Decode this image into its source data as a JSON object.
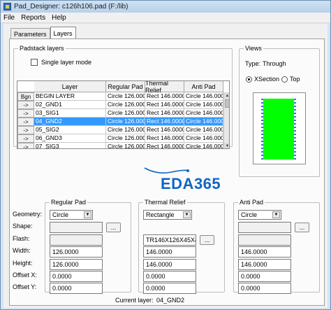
{
  "window": {
    "title": "Pad_Designer: c126h106.pad (F:/lib)"
  },
  "menu": {
    "items": [
      "File",
      "Reports",
      "Help"
    ]
  },
  "tabs": [
    {
      "label": "Parameters",
      "active": false
    },
    {
      "label": "Layers",
      "active": true
    }
  ],
  "padstack": {
    "group_label": "Padstack layers",
    "single_layer_mode_label": "Single layer mode",
    "single_layer_mode_checked": false,
    "bgn_label": "Bgn",
    "columns": [
      "Layer",
      "Regular Pad",
      "Thermal Relief",
      "Anti Pad"
    ],
    "rows": [
      {
        "marker": "",
        "layer": "BEGIN LAYER",
        "regular": "Circle 126.0000",
        "thermal": "Rect 146.0000",
        "anti": "Circle 146.0000",
        "selected": false
      },
      {
        "marker": "->",
        "layer": "02_GND1",
        "regular": "Circle 126.0000",
        "thermal": "Rect 146.0000",
        "anti": "Circle 146.0000",
        "selected": false
      },
      {
        "marker": "->",
        "layer": "03_SIG1",
        "regular": "Circle 126.0000",
        "thermal": "Rect 146.0000",
        "anti": "Circle 146.0000",
        "selected": false
      },
      {
        "marker": "->",
        "layer": "04_GND2",
        "regular": "Circle 126.0000",
        "thermal": "Rect 146.0000",
        "anti": "Circle 146.0000",
        "selected": true
      },
      {
        "marker": "->",
        "layer": "05_SIG2",
        "regular": "Circle 126.0000",
        "thermal": "Rect 146.0000",
        "anti": "Circle 146.0000",
        "selected": false
      },
      {
        "marker": "->",
        "layer": "06_GND3",
        "regular": "Circle 126.0000",
        "thermal": "Rect 146.0000",
        "anti": "Circle 146.0000",
        "selected": false
      },
      {
        "marker": "->",
        "layer": "07_SIG3",
        "regular": "Circle 126.0000",
        "thermal": "Rect 146.0000",
        "anti": "Circle 146.0000",
        "selected": false
      }
    ]
  },
  "views": {
    "group_label": "Views",
    "type_label": "Type:",
    "type_value": "Through",
    "xsection_label": "XSection",
    "top_label": "Top",
    "selected_view": "XSection",
    "pad_color": "#00ff00"
  },
  "watermark": {
    "text": "EDA365",
    "color": "#0f66c4"
  },
  "form": {
    "row_labels": {
      "geometry": "Geometry:",
      "shape": "Shape:",
      "flash": "Flash:",
      "width": "Width:",
      "height": "Height:",
      "offset_x": "Offset X:",
      "offset_y": "Offset Y:"
    },
    "regular_pad": {
      "label": "Regular Pad",
      "geometry": "Circle",
      "shape_value": "",
      "flash_value": "",
      "shape_button": "...",
      "width": "126.0000",
      "height": "126.0000",
      "offset_x": "0.0000",
      "offset_y": "0.0000"
    },
    "thermal_relief": {
      "label": "Thermal Relief",
      "geometry": "Rectangle",
      "flash_value": "TR146X126X45X4",
      "flash_button": "...",
      "width": "146.0000",
      "height": "146.0000",
      "offset_x": "0.0000",
      "offset_y": "0.0000"
    },
    "anti_pad": {
      "label": "Anti Pad",
      "geometry": "Circle",
      "shape_value": "",
      "flash_value": "",
      "shape_button": "...",
      "width": "146.0000",
      "height": "146.0000",
      "offset_x": "0.0000",
      "offset_y": "0.0000"
    }
  },
  "status": {
    "current_layer_label": "Current layer:",
    "current_layer_value": "04_GND2"
  }
}
